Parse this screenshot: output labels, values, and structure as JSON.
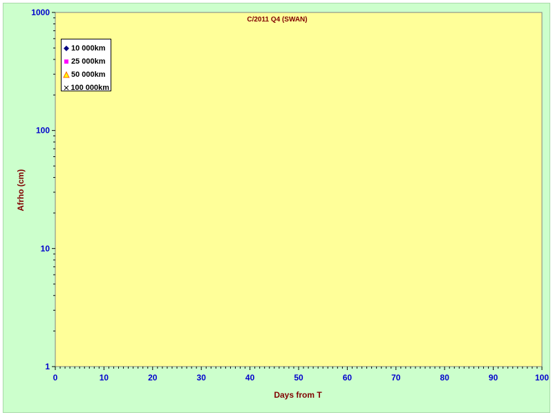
{
  "chart_data": {
    "type": "scatter",
    "title": "C/2011 Q4 (SWAN)",
    "xlabel": "Days from T",
    "ylabel": "Afrho (cm)",
    "xlim": [
      0,
      100
    ],
    "ylim": [
      1,
      1000
    ],
    "yscale": "log",
    "x_ticks": [
      "0",
      "10",
      "20",
      "30",
      "40",
      "50",
      "60",
      "70",
      "80",
      "90",
      "100"
    ],
    "y_ticks": [
      "1",
      "10",
      "100",
      "1000"
    ],
    "series": [
      {
        "name": "10 000km",
        "marker": "diamond",
        "color": "#000080",
        "points": []
      },
      {
        "name": "25 000km",
        "marker": "square",
        "color": "#ff00ff",
        "points": []
      },
      {
        "name": "50 000km",
        "marker": "triangle",
        "color": "#ff6600",
        "points": []
      },
      {
        "name": "100 000km",
        "marker": "x",
        "color": "#000000",
        "points": []
      }
    ],
    "legend_position": "top-left",
    "plot_background": "#ffff99",
    "chart_background": "#ccffcc",
    "grid": false
  }
}
